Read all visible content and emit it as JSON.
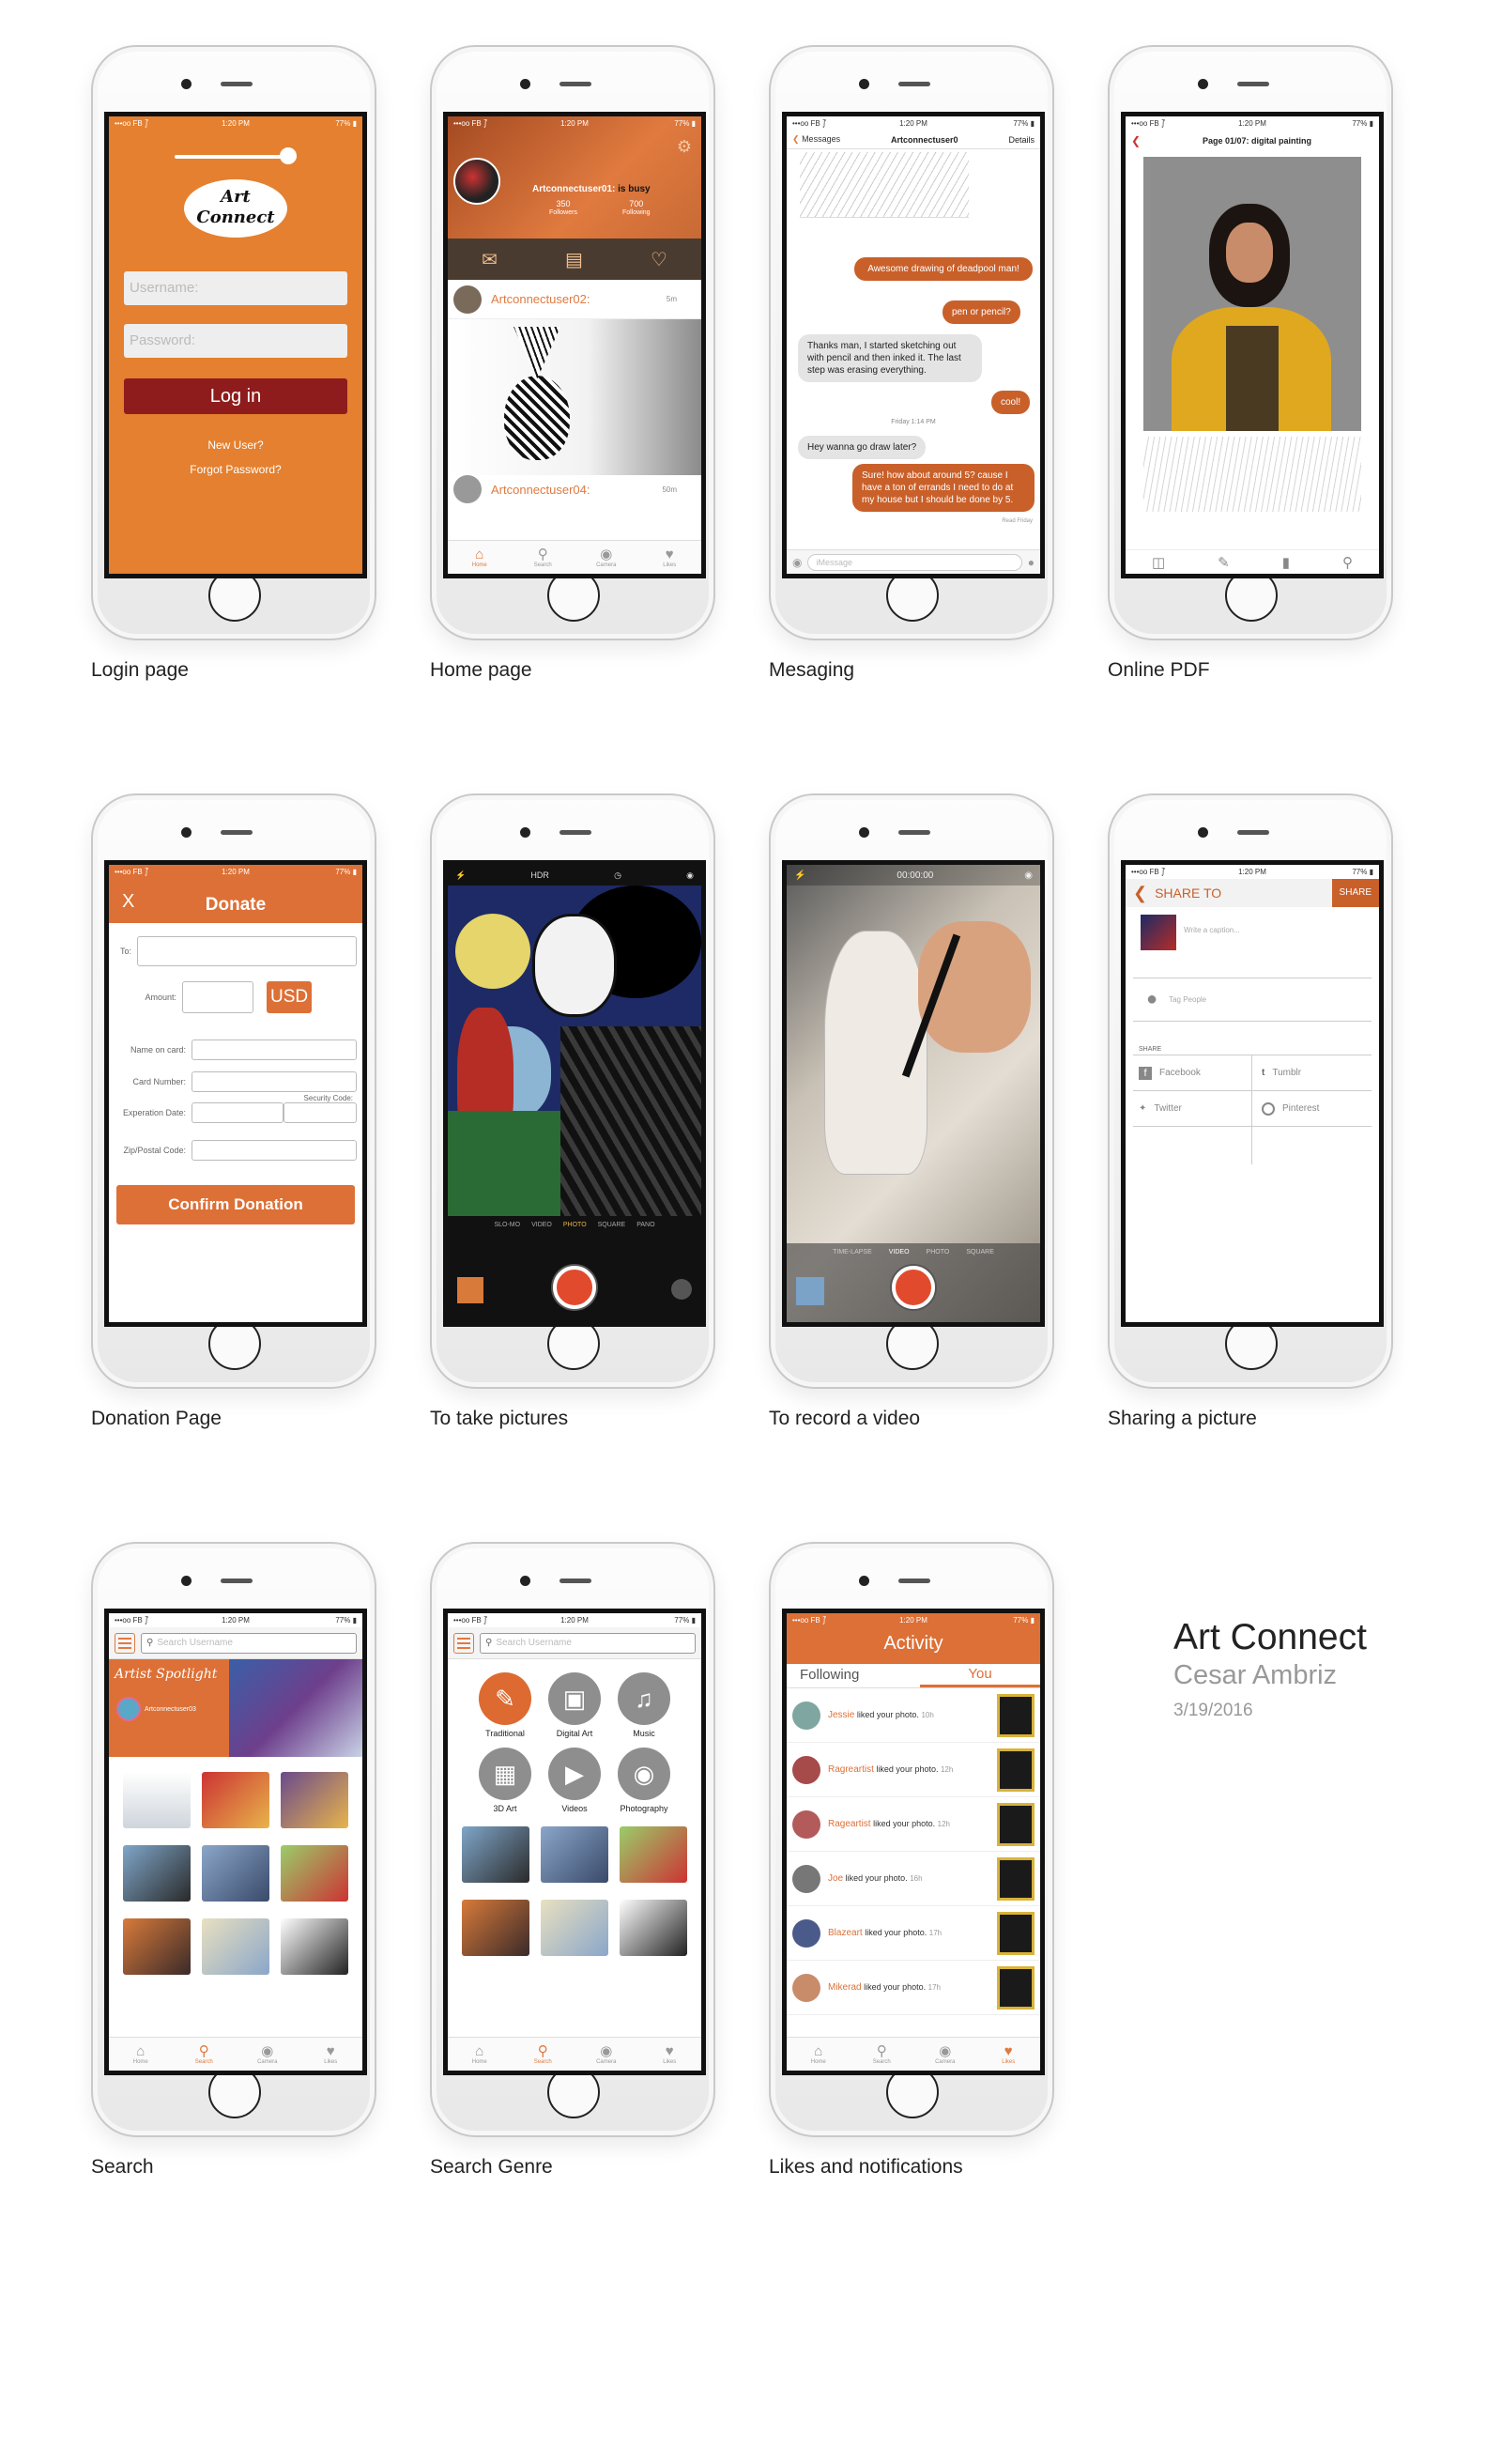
{
  "status": {
    "carrier": "•••oo FB ⨛",
    "time": "1:20 PM",
    "battery": "77% ▮"
  },
  "tabbar": {
    "home": "Home",
    "search": "Search",
    "camera": "Camera",
    "likes": "Likes"
  },
  "screens": {
    "login": {
      "caption": "Login page",
      "logo_text": "Art Connect",
      "username_placeholder": "Username:",
      "password_placeholder": "Password:",
      "login_button": "Log in",
      "new_user": "New User?",
      "forgot_password": "Forgot Password?"
    },
    "home": {
      "caption": "Home page",
      "profile_name": "Artconnectuser01:",
      "profile_status": "is busy",
      "followers_count": "350",
      "followers_label": "Followers",
      "following_count": "700",
      "following_label": "Following",
      "post1_user": "Artconnectuser02:",
      "post1_time": "5m",
      "post2_user": "Artconnectuser04:",
      "post2_time": "50m"
    },
    "messaging": {
      "caption": "Mesaging",
      "back_label": "Messages",
      "contact": "Artconnectuser0",
      "details": "Details",
      "messages": [
        {
          "from": "me",
          "text": "Awesome drawing of deadpool man!"
        },
        {
          "from": "me",
          "text": "pen or pencil?"
        },
        {
          "from": "them",
          "text": "Thanks man, I started sketching out with pencil and then inked it. The last step was erasing everything."
        },
        {
          "from": "me",
          "text": "cool!"
        },
        {
          "from": "them",
          "text": "Hey wanna go draw later?"
        },
        {
          "from": "me",
          "text": "Sure! how about around 5? cause I have a ton of errands I need to do at my house but I should be done by 5."
        }
      ],
      "timestamp": "Friday 1:14 PM",
      "read_receipt": "Read Friday",
      "input_placeholder": "iMessage"
    },
    "pdf": {
      "caption": "Online PDF",
      "title": "Page 01/07: digital painting"
    },
    "donate": {
      "caption": "Donation Page",
      "close": "X",
      "title": "Donate",
      "to_label": "To:",
      "amount_label": "Amount:",
      "currency": "USD",
      "name_label": "Name on card:",
      "card_label": "Card Number:",
      "security_label": "Security Code:",
      "expiration_label": "Experation Date:",
      "zip_label": "Zip/Postal Code:",
      "confirm_button": "Confirm Donation"
    },
    "camera_photo": {
      "caption": "To take pictures",
      "hdr": "HDR",
      "modes": [
        "SLO-MO",
        "VIDEO",
        "PHOTO",
        "SQUARE",
        "PANO"
      ],
      "active_mode": "PHOTO"
    },
    "camera_video": {
      "caption": "To record a video",
      "timer": "00:00:00",
      "modes": [
        "TIME-LAPSE",
        "VIDEO",
        "PHOTO",
        "SQUARE"
      ],
      "active_mode": "VIDEO"
    },
    "share": {
      "caption": "Sharing a picture",
      "title": "SHARE TO",
      "share_button": "SHARE",
      "caption_placeholder": "Write a caption...",
      "tag_people": "Tag People",
      "share_label": "SHARE",
      "networks": [
        "Facebook",
        "Tumblr",
        "Twitter",
        "Pinterest"
      ]
    },
    "search": {
      "caption": "Search",
      "placeholder": "Search Username",
      "spotlight_title": "Artist Spotlight",
      "spotlight_user": "Artconnectuser03"
    },
    "genre": {
      "caption": "Search Genre",
      "placeholder": "Search Username",
      "genres": [
        "Traditional",
        "Digital Art",
        "Music",
        "3D Art",
        "Videos",
        "Photography"
      ]
    },
    "activity": {
      "caption": "Likes and notifications",
      "title": "Activity",
      "tab_following": "Following",
      "tab_you": "You",
      "items": [
        {
          "user": "Jessie",
          "action": "liked your photo.",
          "time": "10h"
        },
        {
          "user": "Ragreartist",
          "action": "liked your photo.",
          "time": "12h"
        },
        {
          "user": "Rageartist",
          "action": "liked your photo.",
          "time": "12h"
        },
        {
          "user": "Joe",
          "action": "liked your photo.",
          "time": "16h"
        },
        {
          "user": "Blazeart",
          "action": "liked your photo.",
          "time": "17h"
        },
        {
          "user": "Mikerad",
          "action": "liked your photo.",
          "time": "17h"
        }
      ]
    }
  },
  "project": {
    "title": "Art Connect",
    "author": "Cesar Ambriz",
    "date": "3/19/2016"
  }
}
